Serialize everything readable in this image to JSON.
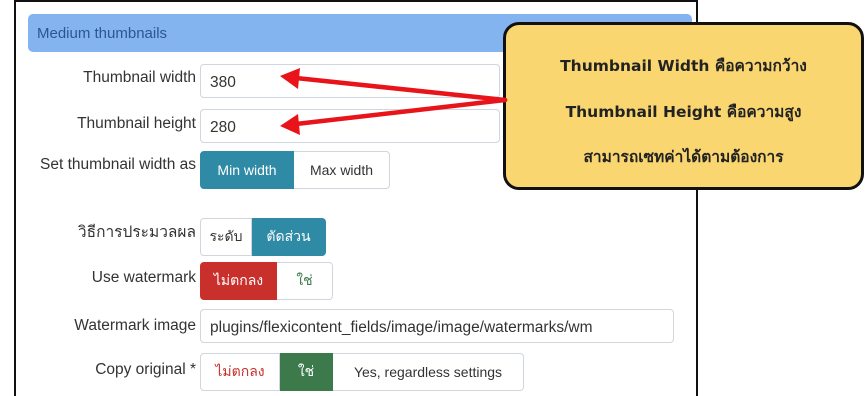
{
  "section": {
    "title": "Medium thumbnails"
  },
  "fields": {
    "thumb_width": {
      "label": "Thumbnail width",
      "value": "380"
    },
    "thumb_height": {
      "label": "Thumbnail height",
      "value": "280"
    },
    "width_as": {
      "label": "Set thumbnail width as",
      "options": [
        "Min width",
        "Max width"
      ],
      "selected": "Min width"
    },
    "process": {
      "label": "วิธีการประมวลผล",
      "options": [
        "ระดับ",
        "ตัดส่วน"
      ],
      "selected": "ตัดส่วน"
    },
    "watermark": {
      "label": "Use watermark",
      "options": [
        "ไม่ตกลง",
        "ใช่"
      ],
      "selected": "ไม่ตกลง"
    },
    "watermark_image": {
      "label": "Watermark image",
      "value": "plugins/flexicontent_fields/image/image/watermarks/wm"
    },
    "copy_original": {
      "label": "Copy original *",
      "options": [
        "ไม่ตกลง",
        "ใช่",
        "Yes, regardless settings"
      ],
      "selected": "ใช่"
    }
  },
  "callout": {
    "lines": [
      "Thumbnail Width คือความกว้าง",
      "Thumbnail Height คือความสูง",
      "สามารถเซทค่าได้ตามต้องการ"
    ],
    "background": "#f9d66f"
  },
  "colors": {
    "header": "#84b4f0",
    "teal": "#2f8aa6",
    "red": "#c9302c",
    "green": "#3c7a4b",
    "arrow": "#e8141a"
  }
}
